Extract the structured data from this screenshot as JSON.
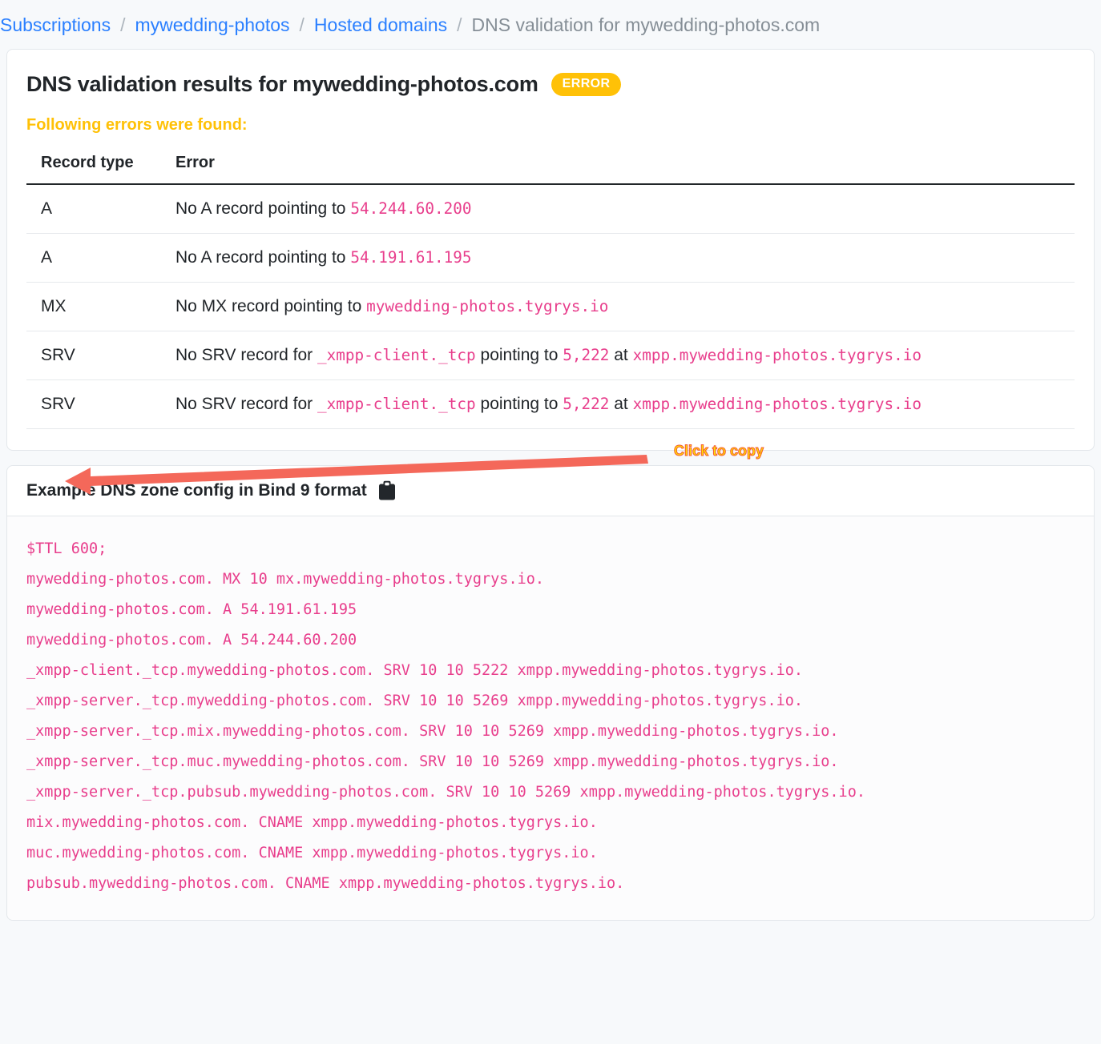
{
  "breadcrumb": {
    "items": [
      {
        "label": "Subscriptions",
        "link": true
      },
      {
        "label": "mywedding-photos",
        "link": true
      },
      {
        "label": "Hosted domains",
        "link": true
      },
      {
        "label": "DNS validation for mywedding-photos.com",
        "link": false
      }
    ],
    "separator": "/"
  },
  "results_card": {
    "title": "DNS validation results for mywedding-photos.com",
    "badge": "ERROR",
    "badge_color": "#ffc107",
    "errors_heading": "Following errors were found:",
    "table": {
      "headers": [
        "Record type",
        "Error"
      ],
      "rows": [
        {
          "record_type": "A",
          "parts": [
            {
              "text": "No A record pointing to ",
              "code": false
            },
            {
              "text": "54.244.60.200",
              "code": true
            }
          ]
        },
        {
          "record_type": "A",
          "parts": [
            {
              "text": "No A record pointing to ",
              "code": false
            },
            {
              "text": "54.191.61.195",
              "code": true
            }
          ]
        },
        {
          "record_type": "MX",
          "parts": [
            {
              "text": "No MX record pointing to ",
              "code": false
            },
            {
              "text": "mywedding-photos.tygrys.io",
              "code": true
            }
          ]
        },
        {
          "record_type": "SRV",
          "parts": [
            {
              "text": "No SRV record for ",
              "code": false
            },
            {
              "text": "_xmpp-client._tcp",
              "code": true
            },
            {
              "text": " pointing to ",
              "code": false
            },
            {
              "text": "5,222",
              "code": true
            },
            {
              "text": " at ",
              "code": false
            },
            {
              "text": "xmpp.mywedding-photos.tygrys.io",
              "code": true
            }
          ]
        },
        {
          "record_type": "SRV",
          "parts": [
            {
              "text": "No SRV record for ",
              "code": false
            },
            {
              "text": "_xmpp-client._tcp",
              "code": true
            },
            {
              "text": " pointing to ",
              "code": false
            },
            {
              "text": "5,222",
              "code": true
            },
            {
              "text": " at ",
              "code": false
            },
            {
              "text": "xmpp.mywedding-photos.tygrys.io",
              "code": true
            }
          ]
        }
      ]
    }
  },
  "zone_card": {
    "title": "Example DNS zone config in Bind 9 format",
    "copy_icon": "clipboard-icon",
    "code_color": "#e83e8c",
    "lines": [
      "$TTL 600;",
      "mywedding-photos.com. MX 10 mx.mywedding-photos.tygrys.io.",
      "mywedding-photos.com. A 54.191.61.195",
      "mywedding-photos.com. A 54.244.60.200",
      "_xmpp-client._tcp.mywedding-photos.com. SRV 10 10 5222 xmpp.mywedding-photos.tygrys.io.",
      "_xmpp-server._tcp.mywedding-photos.com. SRV 10 10 5269 xmpp.mywedding-photos.tygrys.io.",
      "_xmpp-server._tcp.mix.mywedding-photos.com. SRV 10 10 5269 xmpp.mywedding-photos.tygrys.io.",
      "_xmpp-server._tcp.muc.mywedding-photos.com. SRV 10 10 5269 xmpp.mywedding-photos.tygrys.io.",
      "_xmpp-server._tcp.pubsub.mywedding-photos.com. SRV 10 10 5269 xmpp.mywedding-photos.tygrys.io.",
      "mix.mywedding-photos.com. CNAME xmpp.mywedding-photos.tygrys.io.",
      "muc.mywedding-photos.com. CNAME xmpp.mywedding-photos.tygrys.io.",
      "pubsub.mywedding-photos.com. CNAME xmpp.mywedding-photos.tygrys.io."
    ]
  },
  "annotation": {
    "label": "Click to copy",
    "label_color": "#ffe600",
    "arrow_color": "#f4685a"
  }
}
